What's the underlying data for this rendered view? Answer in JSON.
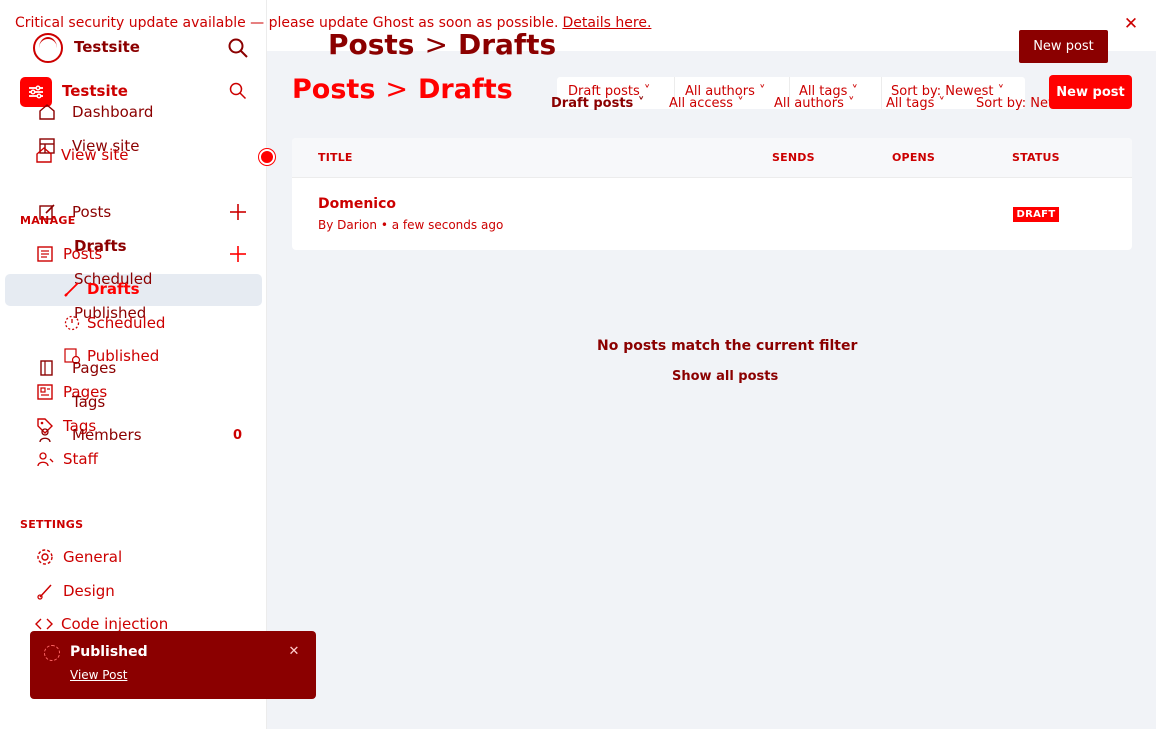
{
  "banner": {
    "text": "Critical security update available — please update Ghost as soon as possible.",
    "link": "Details here."
  },
  "site": {
    "name": "Testsite",
    "name_overlay": "Testsite"
  },
  "header": {
    "breadcrumb_root": "Posts",
    "breadcrumb_separator": ">",
    "breadcrumb_current": "Drafts",
    "new_post_label": "New post"
  },
  "sidebar": {
    "ghost_items": {
      "dashboard": "Dashboard",
      "view_site": "View site",
      "posts": "Posts",
      "drafts": "Drafts",
      "scheduled": "Scheduled",
      "published": "Published",
      "pages": "Pages",
      "tags": "Tags",
      "members": "Members",
      "staff": "Staff"
    },
    "items": {
      "view_site": "View site",
      "manage_label": "MANAGE",
      "posts": "Posts",
      "drafts": "Drafts",
      "scheduled": "Scheduled",
      "published": "Published",
      "pages": "Pages",
      "tags": "Tags",
      "members_count": "0",
      "settings_label": "SETTINGS",
      "general": "General",
      "design": "Design",
      "code_injection": "Code injection"
    }
  },
  "filters": {
    "ghost": {
      "type": "Draft posts",
      "author": "All authors",
      "tags": "All tags",
      "sort": "Sort by: Newest"
    },
    "real": {
      "type": "Draft posts",
      "access": "All access",
      "author": "All authors",
      "tags": "All tags",
      "sort": "Sort by: Newest"
    }
  },
  "table": {
    "headers": {
      "title": "TITLE",
      "sends": "SENDS",
      "opens": "OPENS",
      "status": "STATUS"
    },
    "rows": [
      {
        "title": "Domenico",
        "by": "By",
        "author": "Darion",
        "time": "• a few seconds ago",
        "status": "DRAFT"
      }
    ]
  },
  "empty_state": {
    "message": "No posts match the current filter",
    "link": "Show all posts"
  },
  "toast": {
    "title": "Published",
    "link": "View Post"
  },
  "colors": {
    "primary": "#ff0000",
    "dark": "#8b0000",
    "main_bg": "#f1f3f7"
  }
}
